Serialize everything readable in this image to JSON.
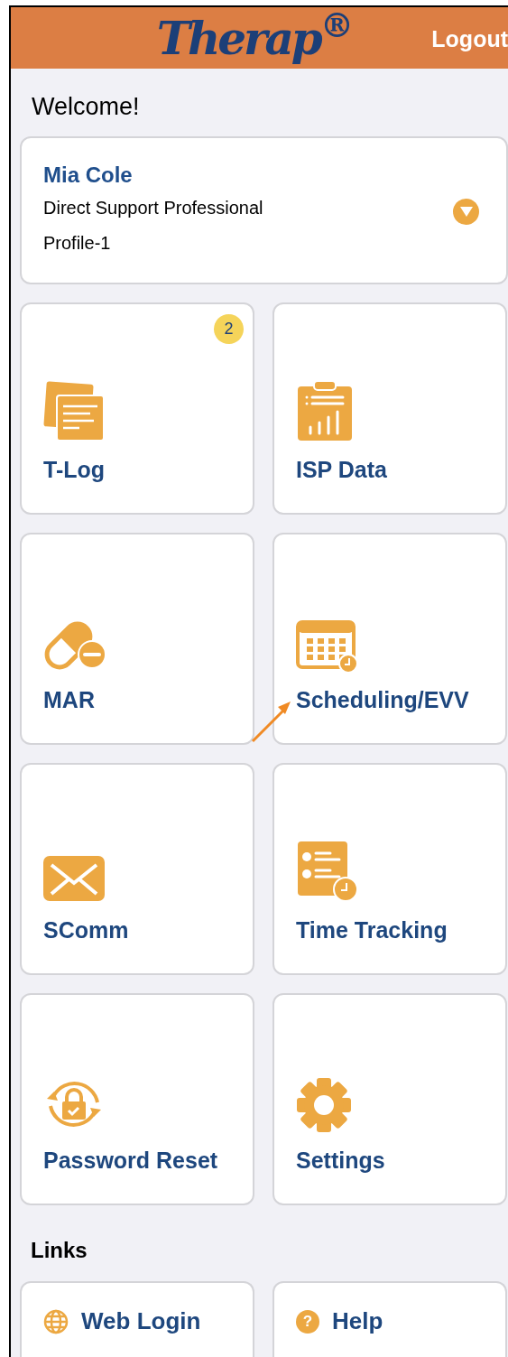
{
  "header": {
    "logo": "Therap$^{®}$",
    "logout": "Logout"
  },
  "welcome": "Welcome!",
  "profile": {
    "name": "Mia Cole",
    "role": "Direct Support Professional",
    "profile": "Profile-1"
  },
  "tiles": [
    {
      "kind": "notes",
      "label": "T-Log",
      "badge": "2"
    },
    {
      "kind": "clipboard",
      "label": "ISP Data"
    },
    {
      "kind": "pill",
      "label": "MAR"
    },
    {
      "kind": "calendar",
      "label": "Scheduling/EVV"
    },
    {
      "kind": "mail",
      "label": "SComm"
    },
    {
      "kind": "checklist",
      "label": "Time Tracking"
    },
    {
      "kind": "lock",
      "label": "Password Reset"
    },
    {
      "kind": "gear",
      "label": "Settings"
    }
  ],
  "links_heading": "Links",
  "links": [
    {
      "kind": "globe",
      "label": "Web Login"
    },
    {
      "kind": "help",
      "label": "Help",
      "icon_text": "?"
    }
  ]
}
